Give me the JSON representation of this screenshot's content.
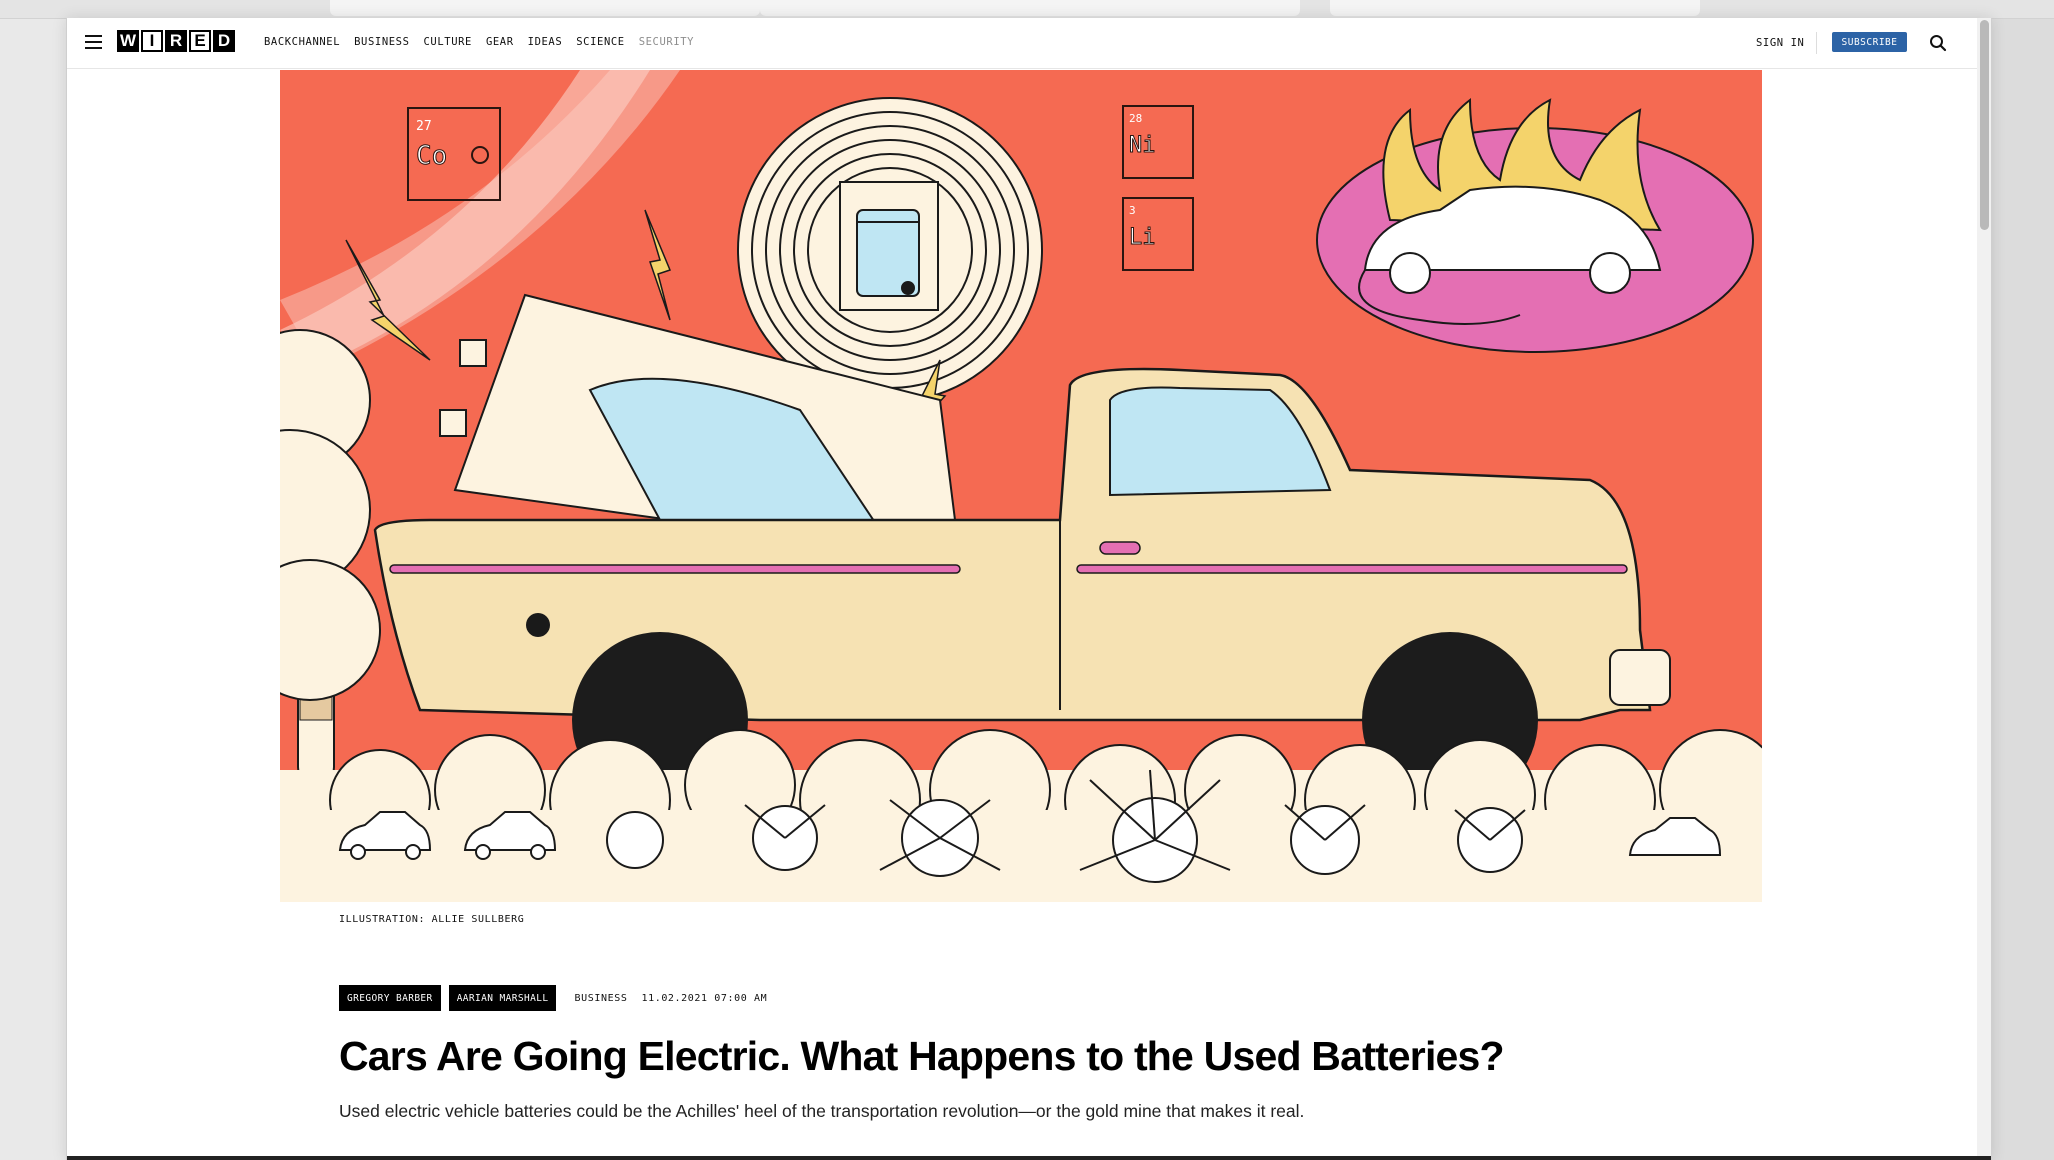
{
  "header": {
    "logo_letters": [
      "W",
      "I",
      "R",
      "E",
      "D"
    ],
    "nav": [
      "BACKCHANNEL",
      "BUSINESS",
      "CULTURE",
      "GEAR",
      "IDEAS",
      "SCIENCE",
      "SECURITY"
    ],
    "sign_in": "SIGN IN",
    "subscribe": "SUBSCRIBE",
    "accent_color": "#2c63a6"
  },
  "hero": {
    "element_labels": [
      "27",
      "Co",
      "28",
      "Ni",
      "3",
      "Li"
    ],
    "background_color": "#f56a52"
  },
  "article": {
    "credit": "ILLUSTRATION: ALLIE SULLBERG",
    "authors": [
      "GREGORY BARBER",
      "AARIAN MARSHALL"
    ],
    "section": "BUSINESS",
    "date": "11.02.2021 07:00 AM",
    "headline": "Cars Are Going Electric. What Happens to the Used Batteries?",
    "dek": "Used electric vehicle batteries could be the Achilles' heel of the transportation revolution—or the gold mine that makes it real."
  }
}
